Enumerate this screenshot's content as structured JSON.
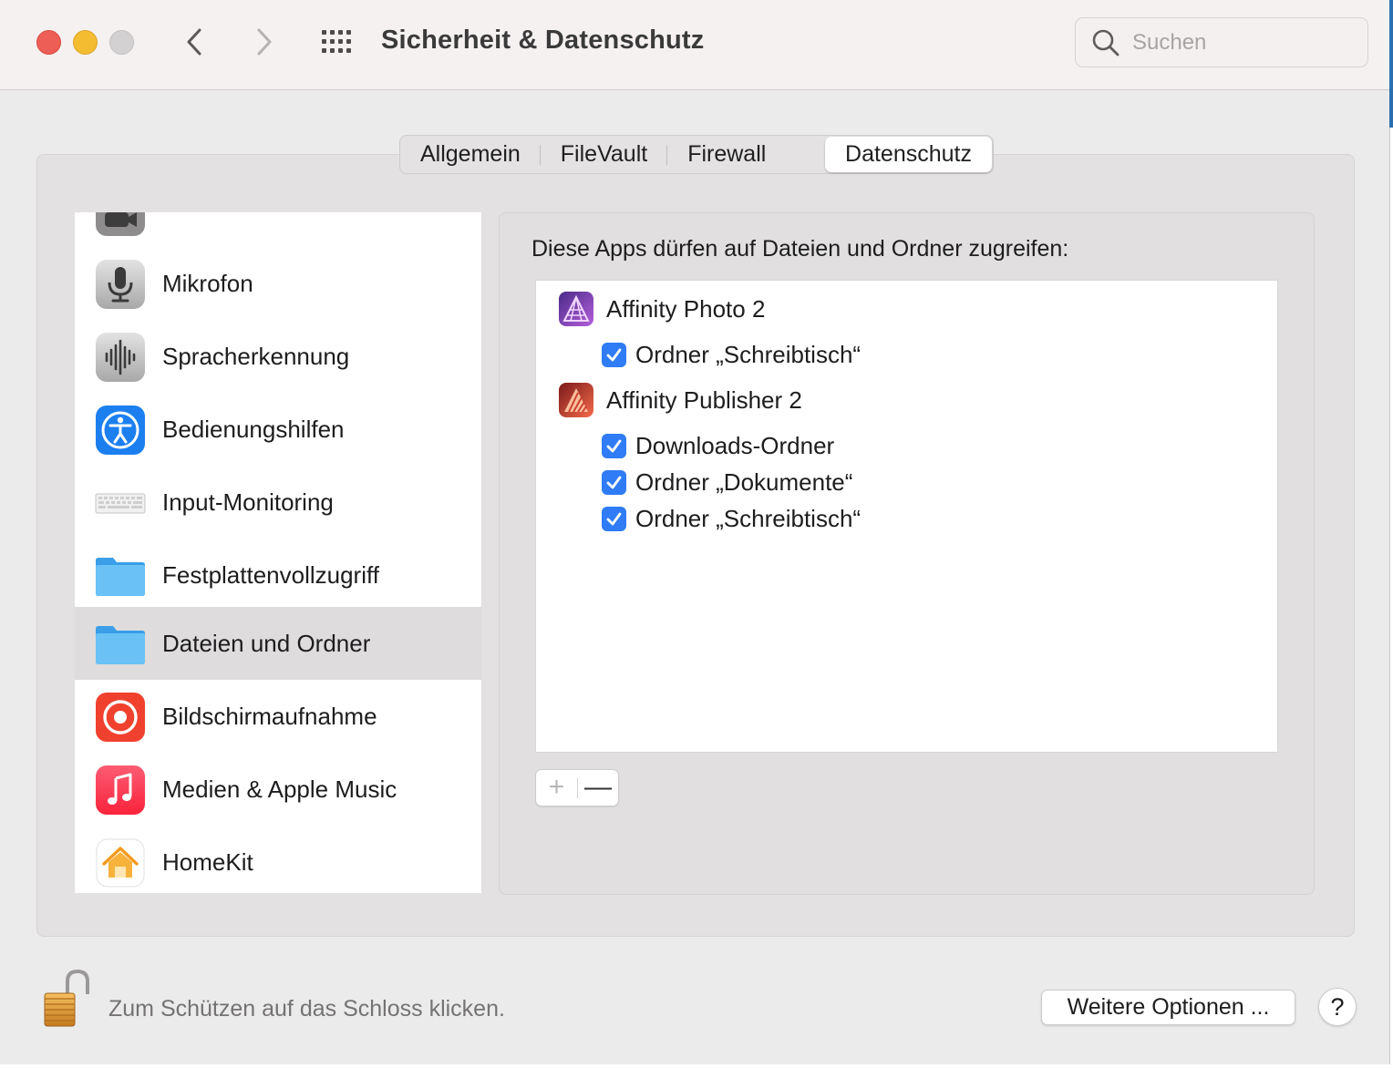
{
  "window": {
    "title": "Sicherheit & Datenschutz",
    "search_placeholder": "Suchen"
  },
  "tabs": [
    {
      "label": "Allgemein",
      "active": false
    },
    {
      "label": "FileVault",
      "active": false
    },
    {
      "label": "Firewall",
      "active": false
    },
    {
      "label": "Datenschutz",
      "active": true
    }
  ],
  "sidebar": {
    "items": [
      {
        "label": "Mikrofon",
        "icon": "microphone-icon"
      },
      {
        "label": "Spracherkennung",
        "icon": "waveform-icon"
      },
      {
        "label": "Bedienungshilfen",
        "icon": "accessibility-icon"
      },
      {
        "label": "Input-Monitoring",
        "icon": "keyboard-icon"
      },
      {
        "label": "Festplattenvollzugriff",
        "icon": "folder-icon"
      },
      {
        "label": "Dateien und Ordner",
        "icon": "folder-icon",
        "selected": true
      },
      {
        "label": "Bildschirmaufnahme",
        "icon": "screen-recording-icon"
      },
      {
        "label": "Medien & Apple Music",
        "icon": "music-icon"
      },
      {
        "label": "HomeKit",
        "icon": "home-icon"
      }
    ]
  },
  "panel": {
    "heading": "Diese Apps dürfen auf Dateien und Ordner zugreifen:",
    "apps": [
      {
        "name": "Affinity Photo 2",
        "icon": "affinity-photo-icon",
        "permissions": [
          {
            "label": "Ordner „Schreibtisch“",
            "checked": true
          }
        ]
      },
      {
        "name": "Affinity Publisher 2",
        "icon": "affinity-publisher-icon",
        "permissions": [
          {
            "label": "Downloads-Ordner",
            "checked": true
          },
          {
            "label": "Ordner „Dokumente“",
            "checked": true
          },
          {
            "label": "Ordner „Schreibtisch“",
            "checked": true
          }
        ]
      }
    ],
    "add_symbol": "+",
    "remove_symbol": "—"
  },
  "footer": {
    "lock_text": "Zum Schützen auf das Schloss klicken.",
    "more_options_label": "Weitere Optionen ...",
    "help_label": "?"
  },
  "colors": {
    "accent": "#2f7cf6",
    "close": "#ed5f56",
    "minimize": "#f4bd31",
    "zoom_disabled": "#d3d1d1"
  }
}
